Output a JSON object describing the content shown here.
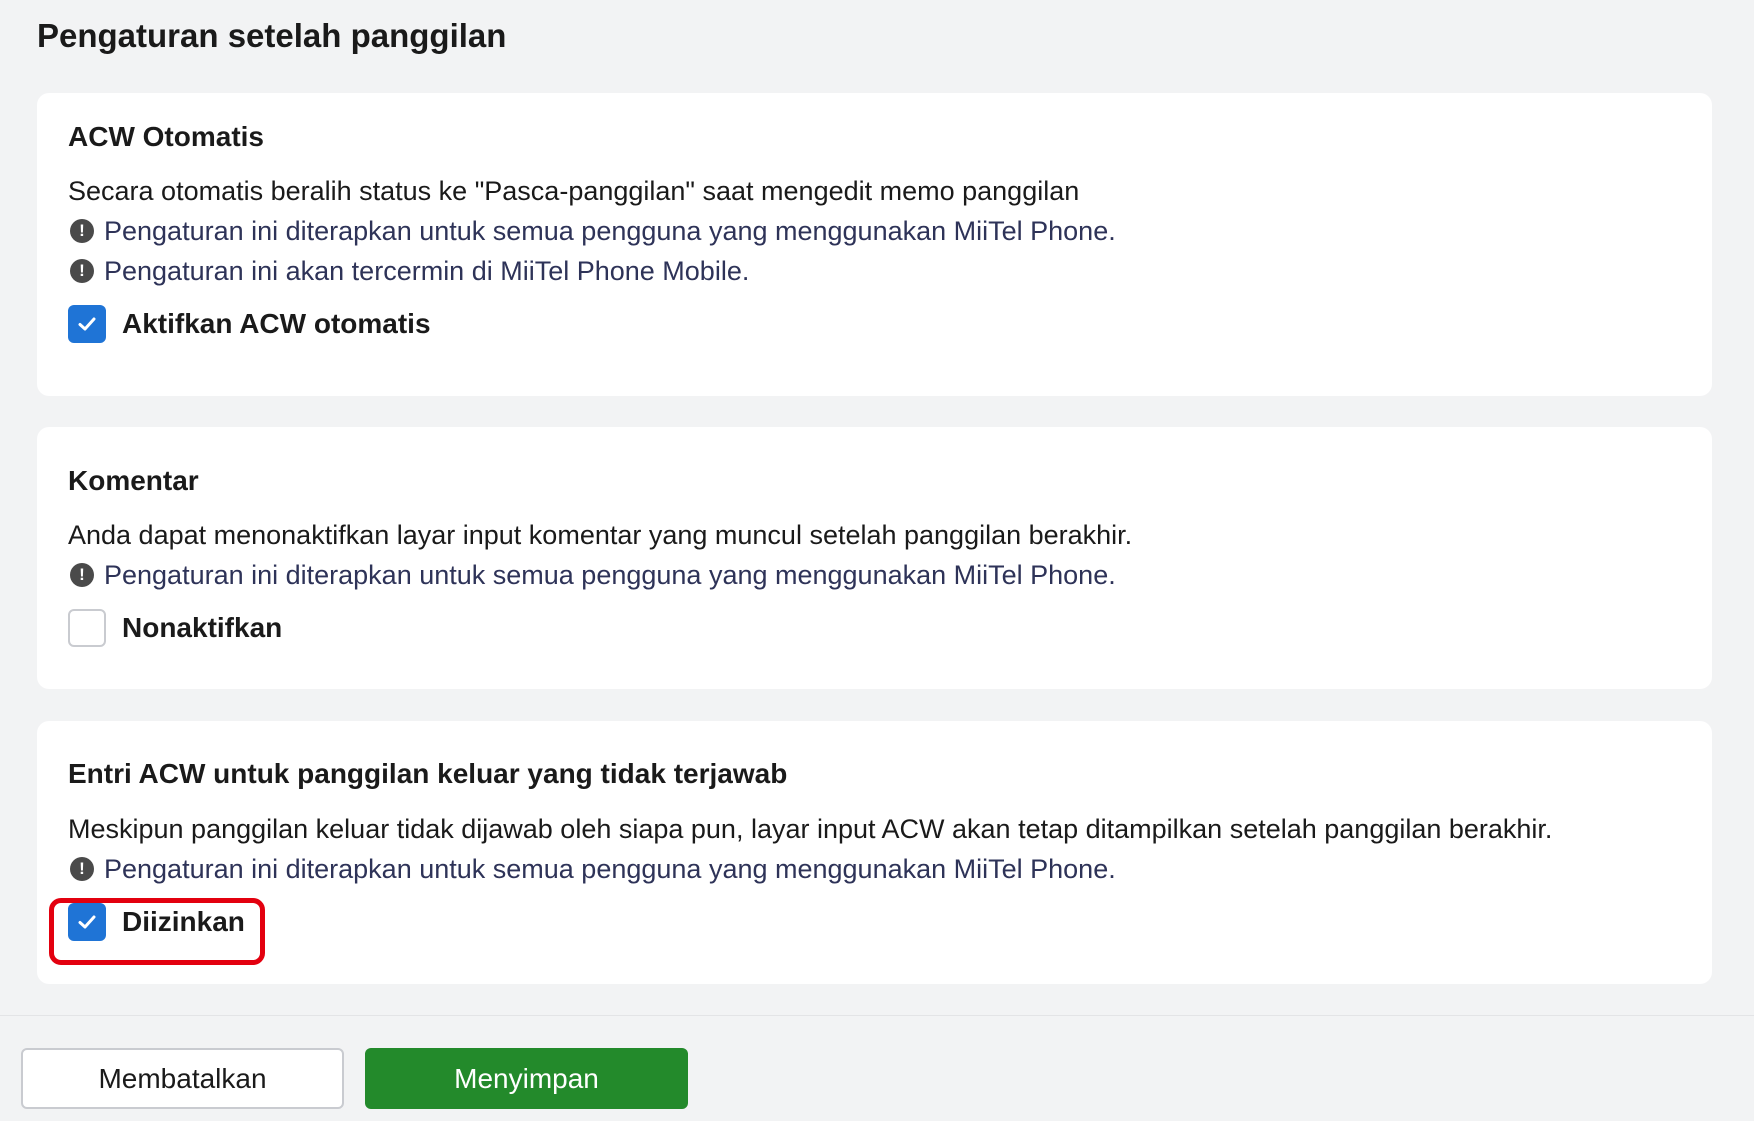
{
  "page": {
    "title": "Pengaturan setelah panggilan"
  },
  "sections": [
    {
      "title": "ACW Otomatis",
      "description": "Secara otomatis beralih status ke \"Pasca-panggilan\" saat mengedit memo panggilan",
      "notes": [
        "Pengaturan ini diterapkan untuk semua pengguna yang menggunakan MiiTel Phone.",
        "Pengaturan ini akan tercermin di MiiTel Phone Mobile."
      ],
      "checkbox": {
        "label": "Aktifkan ACW otomatis",
        "checked": true
      }
    },
    {
      "title": "Komentar",
      "description": "Anda dapat menonaktifkan layar input komentar yang muncul setelah panggilan berakhir.",
      "notes": [
        "Pengaturan ini diterapkan untuk semua pengguna yang menggunakan MiiTel Phone."
      ],
      "checkbox": {
        "label": "Nonaktifkan",
        "checked": false
      }
    },
    {
      "title": "Entri ACW untuk panggilan keluar yang tidak terjawab",
      "description": "Meskipun panggilan keluar tidak dijawab oleh siapa pun, layar input ACW akan tetap ditampilkan setelah panggilan berakhir.",
      "notes": [
        "Pengaturan ini diterapkan untuk semua pengguna yang menggunakan MiiTel Phone."
      ],
      "checkbox": {
        "label": "Diizinkan",
        "checked": true
      }
    }
  ],
  "footer": {
    "cancel_label": "Membatalkan",
    "save_label": "Menyimpan"
  },
  "icons": {
    "note": "exclamation-circle-icon",
    "check": "checkmark-icon"
  },
  "colors": {
    "background": "#f2f3f4",
    "card": "#ffffff",
    "checkbox_checked": "#1f74d6",
    "note_text": "#2e3358",
    "save_button": "#238a2b",
    "highlight": "#e3000f"
  }
}
